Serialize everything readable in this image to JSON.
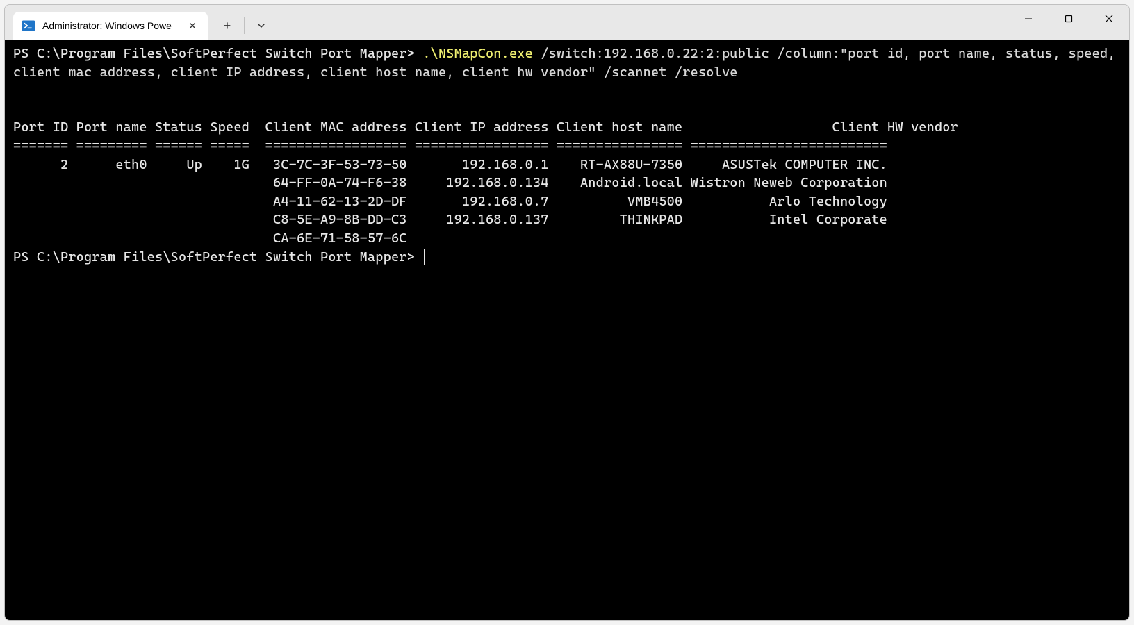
{
  "window": {
    "tab_title": "Administrator: Windows Powe"
  },
  "terminal": {
    "prompt1": "PS C:\\Program Files\\SoftPerfect Switch Port Mapper> ",
    "exe": ".\\NSMapCon.exe",
    "args": " /switch:192.168.0.22:2:public /column:\"port id, port name, status, speed, client mac address, client IP address, client host name, client hw vendor\" /scannet /resolve",
    "headers": {
      "port_id": "Port ID",
      "port_name": "Port name",
      "status": "Status",
      "speed": "Speed",
      "mac": "Client MAC address",
      "ip": "Client IP address",
      "host": "Client host name",
      "vendor": "Client HW vendor"
    },
    "separators": {
      "port_id": "=======",
      "port_name": "=========",
      "status": "======",
      "speed": "=====",
      "mac": "==================",
      "ip": "=================",
      "host": "================",
      "vendor": "========================="
    },
    "rows": [
      {
        "port_id": "2",
        "port_name": "eth0",
        "status": "Up",
        "speed": "1G",
        "mac": "3C-7C-3F-53-73-50",
        "ip": "192.168.0.1",
        "host": "RT-AX88U-7350",
        "vendor": "ASUSTek COMPUTER INC."
      },
      {
        "port_id": "",
        "port_name": "",
        "status": "",
        "speed": "",
        "mac": "64-FF-0A-74-F6-38",
        "ip": "192.168.0.134",
        "host": "Android.local",
        "vendor": "Wistron Neweb Corporation"
      },
      {
        "port_id": "",
        "port_name": "",
        "status": "",
        "speed": "",
        "mac": "A4-11-62-13-2D-DF",
        "ip": "192.168.0.7",
        "host": "VMB4500",
        "vendor": "Arlo Technology"
      },
      {
        "port_id": "",
        "port_name": "",
        "status": "",
        "speed": "",
        "mac": "C8-5E-A9-8B-DD-C3",
        "ip": "192.168.0.137",
        "host": "THINKPAD",
        "vendor": "Intel Corporate"
      },
      {
        "port_id": "",
        "port_name": "",
        "status": "",
        "speed": "",
        "mac": "CA-6E-71-58-57-6C",
        "ip": "",
        "host": "",
        "vendor": ""
      }
    ],
    "prompt2": "PS C:\\Program Files\\SoftPerfect Switch Port Mapper> "
  }
}
